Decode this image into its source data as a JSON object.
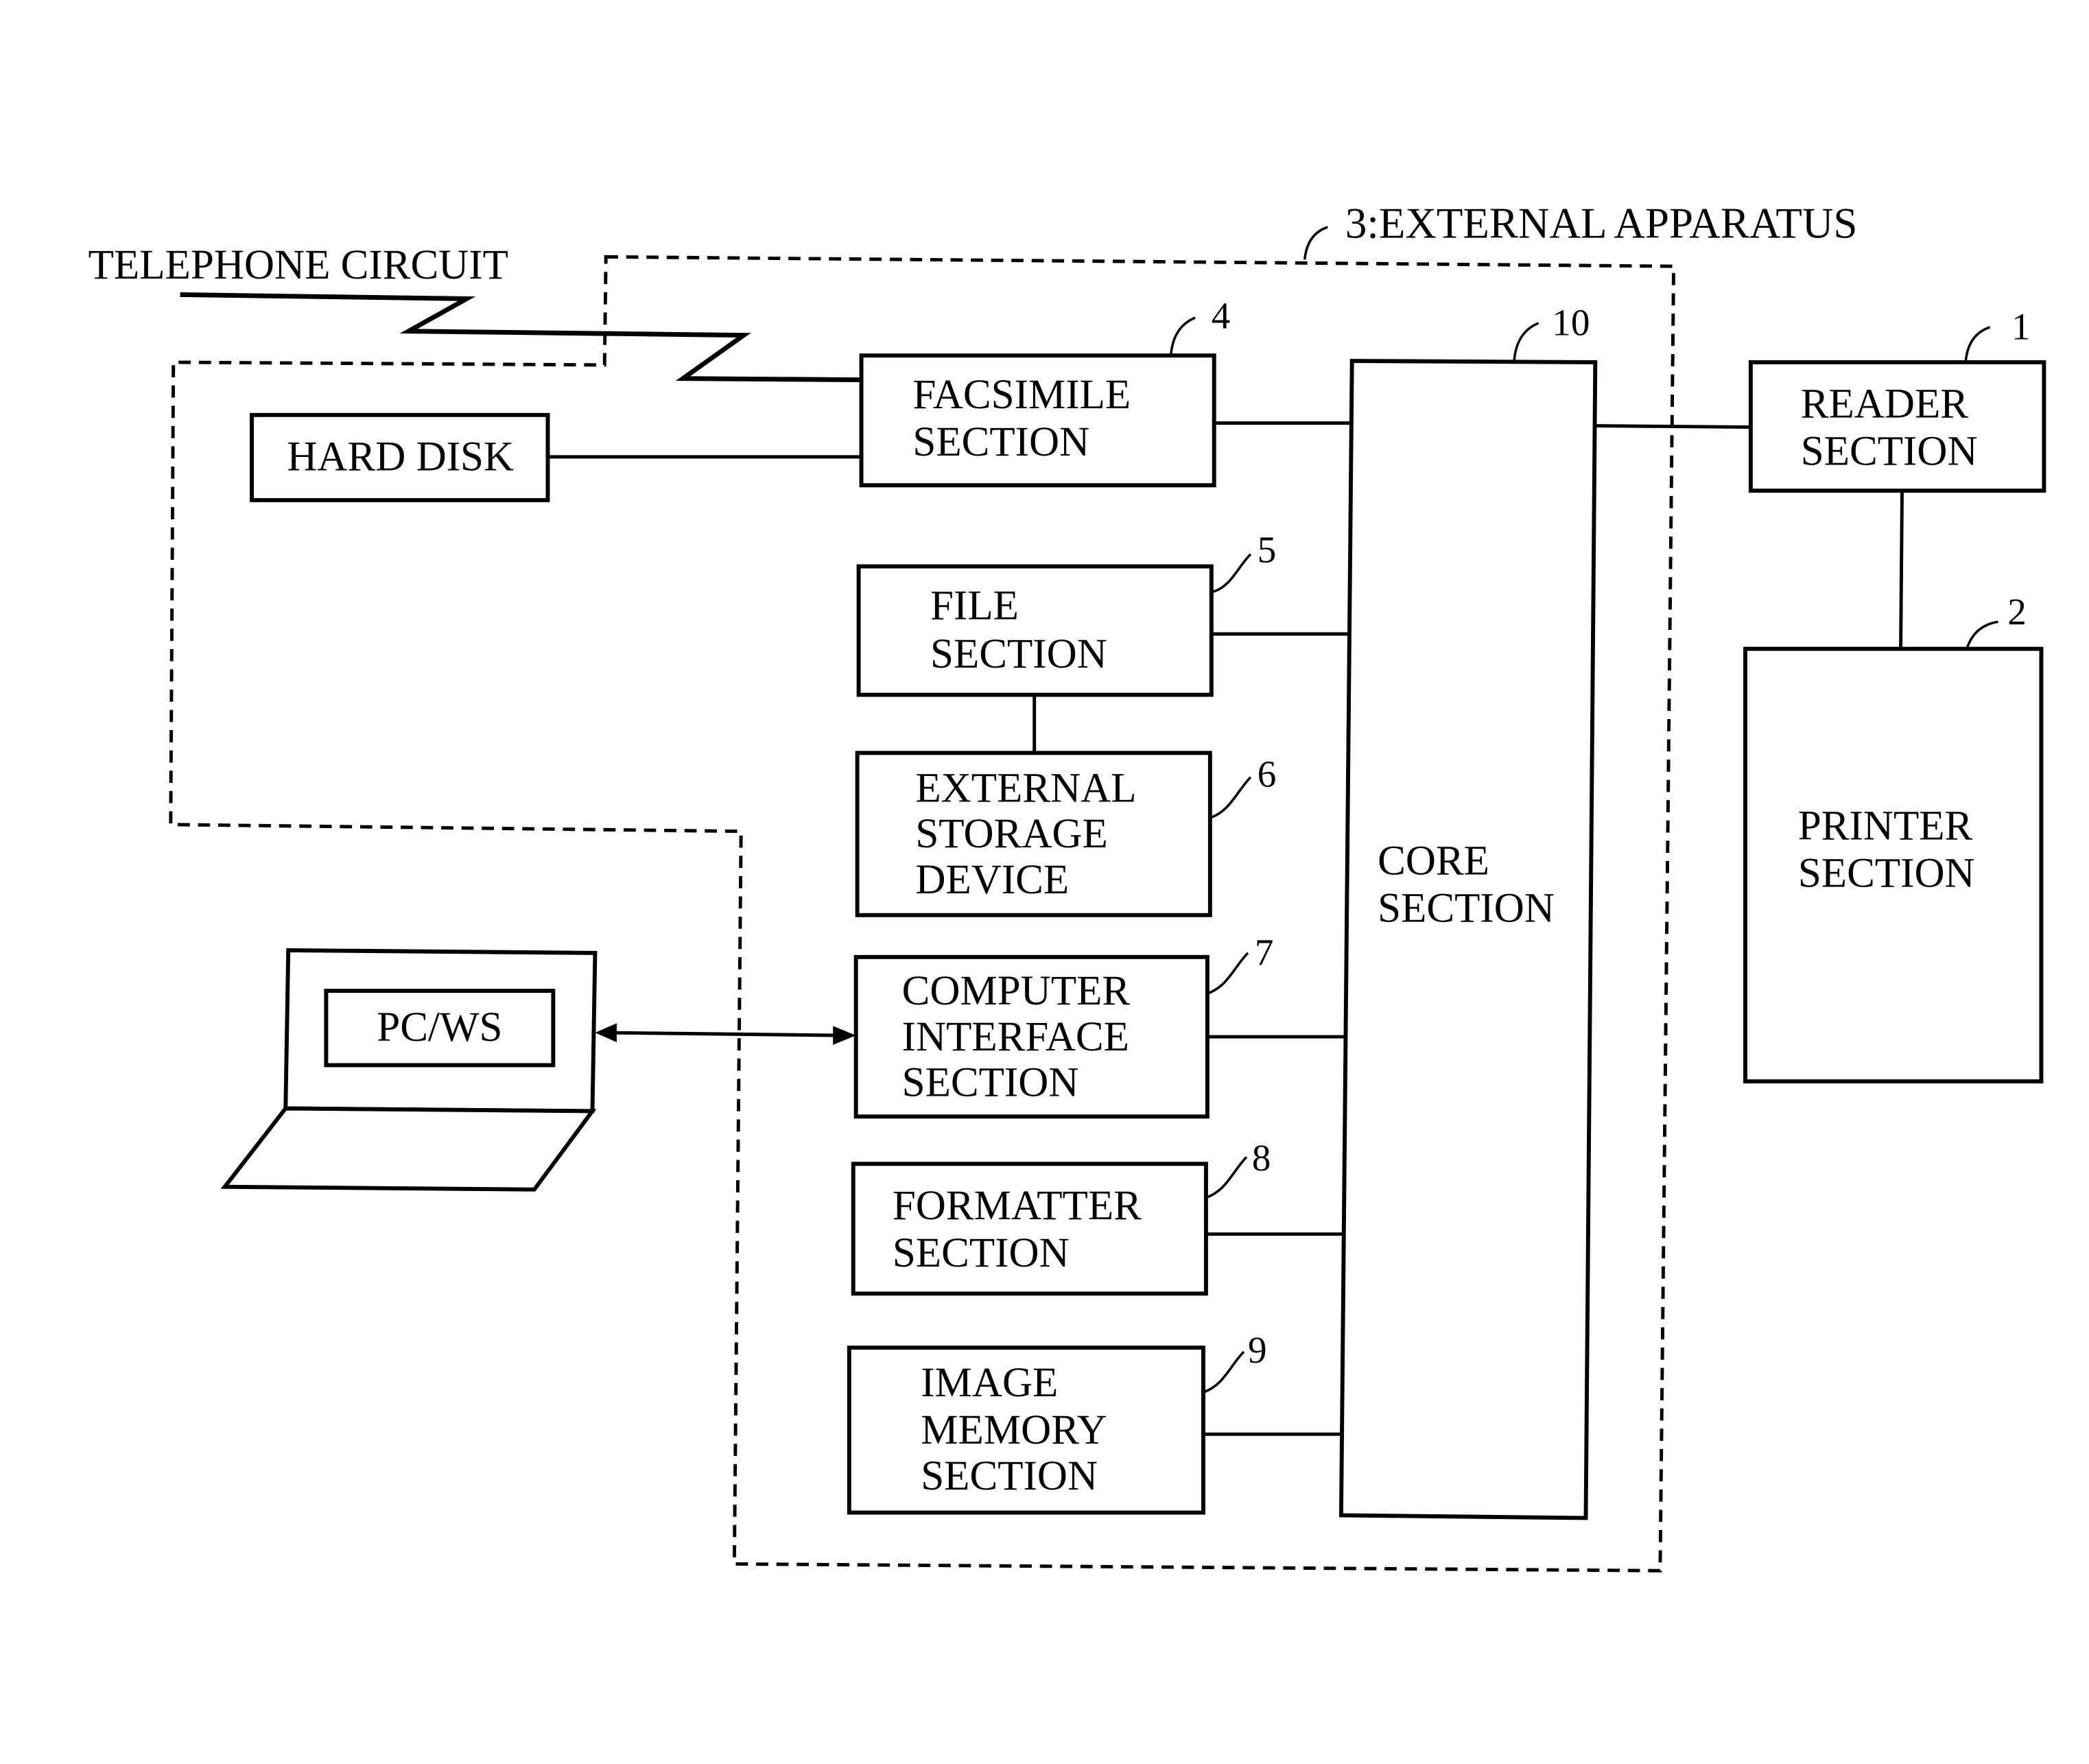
{
  "figure": {
    "type": "block-diagram",
    "colors": {
      "ink": "#000000",
      "background": "#ffffff"
    }
  },
  "external_apparatus": {
    "ref": "3",
    "label": "3:EXTERNAL APPARATUS"
  },
  "telephone_circuit": {
    "label": "TELEPHONE CIRCUIT"
  },
  "blocks": {
    "hard_disk": {
      "lines": [
        "HARD DISK"
      ]
    },
    "facsimile": {
      "ref": "4",
      "lines": [
        "FACSIMILE",
        "SECTION"
      ]
    },
    "file": {
      "ref": "5",
      "lines": [
        "FILE",
        "SECTION"
      ]
    },
    "external_storage": {
      "ref": "6",
      "lines": [
        "EXTERNAL",
        "STORAGE",
        "DEVICE"
      ]
    },
    "computer_interface": {
      "ref": "7",
      "lines": [
        "COMPUTER",
        "INTERFACE",
        "SECTION"
      ]
    },
    "formatter": {
      "ref": "8",
      "lines": [
        "FORMATTER",
        "SECTION"
      ]
    },
    "image_memory": {
      "ref": "9",
      "lines": [
        "IMAGE",
        "MEMORY",
        "SECTION"
      ]
    },
    "core": {
      "ref": "10",
      "lines": [
        "CORE",
        "SECTION"
      ]
    },
    "reader": {
      "ref": "1",
      "lines": [
        "READER",
        "SECTION"
      ]
    },
    "printer": {
      "ref": "2",
      "lines": [
        "PRINTER",
        "SECTION"
      ]
    },
    "pcws": {
      "lines": [
        "PC/WS"
      ]
    }
  },
  "connections": [
    {
      "from": "telephone_circuit",
      "to": "facsimile"
    },
    {
      "from": "hard_disk",
      "to": "facsimile"
    },
    {
      "from": "facsimile",
      "to": "core"
    },
    {
      "from": "file",
      "to": "core"
    },
    {
      "from": "file",
      "to": "external_storage"
    },
    {
      "from": "pcws",
      "to": "computer_interface",
      "bidirectional": true
    },
    {
      "from": "computer_interface",
      "to": "core"
    },
    {
      "from": "formatter",
      "to": "core"
    },
    {
      "from": "image_memory",
      "to": "core"
    },
    {
      "from": "core",
      "to": "reader"
    },
    {
      "from": "reader",
      "to": "printer"
    }
  ]
}
